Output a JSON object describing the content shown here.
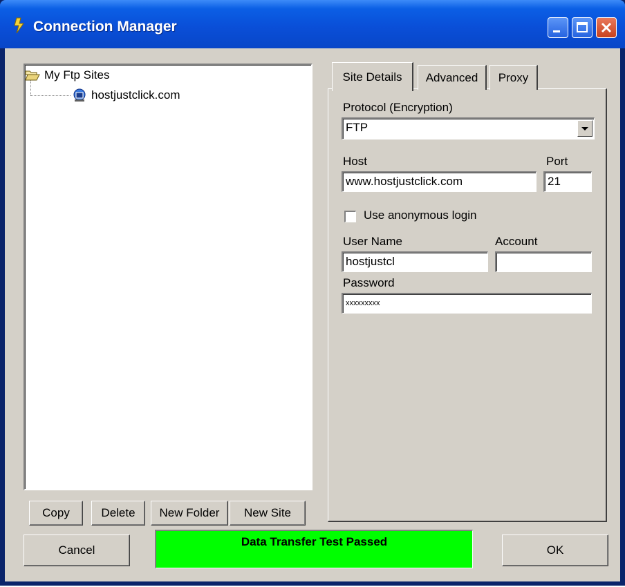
{
  "window": {
    "title": "Connection Manager",
    "title_icon": "lightning-bolt-icon",
    "controls": [
      "minimize-icon",
      "maximize-icon",
      "close-icon"
    ]
  },
  "tree": {
    "root_label": "My Ftp Sites",
    "root_icon": "folder-open-icon",
    "sites": [
      {
        "label": "hostjustclick.com",
        "icon": "globe-site-icon"
      }
    ]
  },
  "tree_buttons": {
    "copy": "Copy",
    "delete": "Delete",
    "new_folder": "New Folder",
    "new_site": "New Site"
  },
  "tabs": [
    {
      "label": "Site Details",
      "active": true
    },
    {
      "label": "Advanced",
      "active": false
    },
    {
      "label": "Proxy",
      "active": false
    }
  ],
  "site_details": {
    "protocol_label": "Protocol (Encryption)",
    "protocol_value": "FTP",
    "host_label": "Host",
    "host_value": "www.hostjustclick.com",
    "port_label": "Port",
    "port_value": "21",
    "anonymous_label": "Use anonymous login",
    "anonymous_checked": false,
    "username_label": "User Name",
    "username_value": "hostjustcl",
    "account_label": "Account",
    "account_value": "",
    "password_label": "Password",
    "password_value": "xxxxxxxxx"
  },
  "footer": {
    "cancel": "Cancel",
    "status": "Data Transfer Test Passed",
    "ok": "OK"
  },
  "colors": {
    "titlebar": "#0a4fd8",
    "face": "#d4d0c8",
    "status_bg": "#00ff00"
  }
}
